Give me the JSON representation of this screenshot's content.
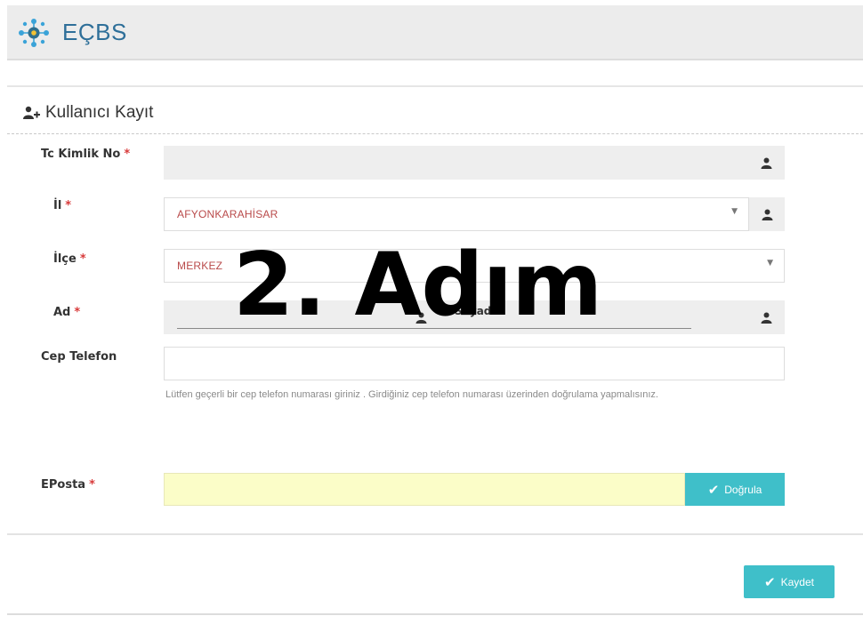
{
  "app": {
    "brand": "EÇBS"
  },
  "panel": {
    "title": "Kullanıcı Kayıt"
  },
  "form": {
    "tc": {
      "label": "Tc Kimlik No",
      "required": "*",
      "value": ""
    },
    "il": {
      "label": "İl",
      "required": "*",
      "selected": "AFYONKARAHİSAR"
    },
    "ilce": {
      "label": "İlçe",
      "required": "*",
      "selected": "MERKEZ"
    },
    "ad": {
      "label": "Ad",
      "required": "*",
      "value": "",
      "soyad_label": "Soyad"
    },
    "cep": {
      "label": "Cep Telefon",
      "value": "",
      "help": "Lütfen geçerli bir cep telefon numarası giriniz . Girdiğiniz cep telefon numarası üzerinden doğrulama yapmalısınız."
    },
    "eposta": {
      "label": "EPosta",
      "required": "*",
      "value": ""
    }
  },
  "buttons": {
    "verify": "Doğrula",
    "save": "Kaydet"
  },
  "overlay": {
    "text": "2. Adım"
  },
  "icons": {
    "logo": "network-gear-icon",
    "user_add": "user-plus-icon",
    "person": "user-icon",
    "dropdown": "caret-down-icon",
    "check": "check-icon"
  },
  "colors": {
    "brand": "#2e6f99",
    "accent": "#3fbfc9",
    "required": "#d83a3a",
    "selected_text": "#b94a4a",
    "email_bg": "#fbfdc8"
  }
}
